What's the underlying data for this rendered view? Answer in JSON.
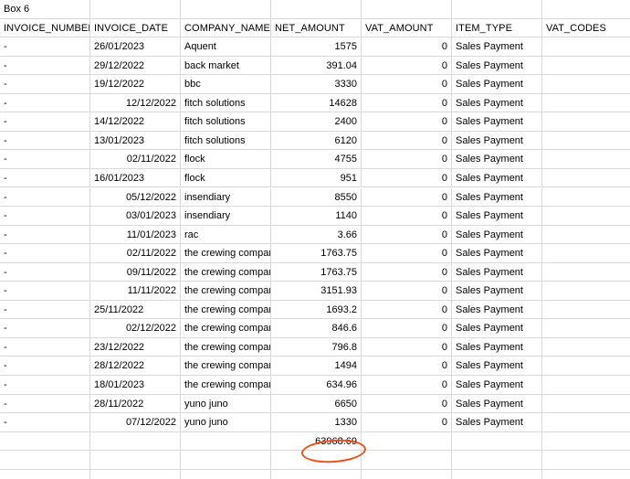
{
  "sheet": {
    "title": "Box 6",
    "headers": [
      "INVOICE_NUMBER",
      "INVOICE_DATE",
      "COMPANY_NAME",
      "NET_AMOUNT",
      "VAT_AMOUNT",
      "ITEM_TYPE",
      "VAT_CODES"
    ],
    "rows": [
      {
        "invoice_number": "-",
        "invoice_date": "26/01/2023",
        "date_align": "left",
        "company": "Aquent",
        "net": "1575",
        "vat": "0",
        "item_type": "Sales Payment",
        "vat_codes": ""
      },
      {
        "invoice_number": "-",
        "invoice_date": "29/12/2022",
        "date_align": "left",
        "company": "back market",
        "net": "391.04",
        "vat": "0",
        "item_type": "Sales Payment",
        "vat_codes": ""
      },
      {
        "invoice_number": "-",
        "invoice_date": "19/12/2022",
        "date_align": "left",
        "company": "bbc",
        "net": "3330",
        "vat": "0",
        "item_type": "Sales Payment",
        "vat_codes": ""
      },
      {
        "invoice_number": "-",
        "invoice_date": "12/12/2022",
        "date_align": "right",
        "company": "fitch solutions",
        "net": "14628",
        "vat": "0",
        "item_type": "Sales Payment",
        "vat_codes": ""
      },
      {
        "invoice_number": "-",
        "invoice_date": "14/12/2022",
        "date_align": "left",
        "company": "fitch solutions",
        "net": "2400",
        "vat": "0",
        "item_type": "Sales Payment",
        "vat_codes": ""
      },
      {
        "invoice_number": "-",
        "invoice_date": "13/01/2023",
        "date_align": "left",
        "company": "fitch solutions",
        "net": "6120",
        "vat": "0",
        "item_type": "Sales Payment",
        "vat_codes": ""
      },
      {
        "invoice_number": "-",
        "invoice_date": "02/11/2022",
        "date_align": "right",
        "company": "flock",
        "net": "4755",
        "vat": "0",
        "item_type": "Sales Payment",
        "vat_codes": ""
      },
      {
        "invoice_number": "-",
        "invoice_date": "16/01/2023",
        "date_align": "left",
        "company": "flock",
        "net": "951",
        "vat": "0",
        "item_type": "Sales Payment",
        "vat_codes": ""
      },
      {
        "invoice_number": "-",
        "invoice_date": "05/12/2022",
        "date_align": "right",
        "company": "insendiary",
        "net": "8550",
        "vat": "0",
        "item_type": "Sales Payment",
        "vat_codes": ""
      },
      {
        "invoice_number": "-",
        "invoice_date": "03/01/2023",
        "date_align": "right",
        "company": "insendiary",
        "net": "1140",
        "vat": "0",
        "item_type": "Sales Payment",
        "vat_codes": ""
      },
      {
        "invoice_number": "-",
        "invoice_date": "11/01/2023",
        "date_align": "right",
        "company": "rac",
        "net": "3.66",
        "vat": "0",
        "item_type": "Sales Payment",
        "vat_codes": ""
      },
      {
        "invoice_number": "-",
        "invoice_date": "02/11/2022",
        "date_align": "right",
        "company": "the crewing compan",
        "net": "1763.75",
        "vat": "0",
        "item_type": "Sales Payment",
        "vat_codes": ""
      },
      {
        "invoice_number": "-",
        "invoice_date": "09/11/2022",
        "date_align": "right",
        "company": "the crewing compan",
        "net": "1763.75",
        "vat": "0",
        "item_type": "Sales Payment",
        "vat_codes": ""
      },
      {
        "invoice_number": "-",
        "invoice_date": "11/11/2022",
        "date_align": "right",
        "company": "the crewing compan",
        "net": "3151.93",
        "vat": "0",
        "item_type": "Sales Payment",
        "vat_codes": ""
      },
      {
        "invoice_number": "-",
        "invoice_date": "25/11/2022",
        "date_align": "left",
        "company": "the crewing compan",
        "net": "1693.2",
        "vat": "0",
        "item_type": "Sales Payment",
        "vat_codes": ""
      },
      {
        "invoice_number": "-",
        "invoice_date": "02/12/2022",
        "date_align": "right",
        "company": "the crewing compan",
        "net": "846.6",
        "vat": "0",
        "item_type": "Sales Payment",
        "vat_codes": ""
      },
      {
        "invoice_number": "-",
        "invoice_date": "23/12/2022",
        "date_align": "left",
        "company": "the crewing compan",
        "net": "796.8",
        "vat": "0",
        "item_type": "Sales Payment",
        "vat_codes": ""
      },
      {
        "invoice_number": "-",
        "invoice_date": "28/12/2022",
        "date_align": "left",
        "company": "the crewing compan",
        "net": "1494",
        "vat": "0",
        "item_type": "Sales Payment",
        "vat_codes": ""
      },
      {
        "invoice_number": "-",
        "invoice_date": "18/01/2023",
        "date_align": "left",
        "company": "the crewing compan",
        "net": "634.96",
        "vat": "0",
        "item_type": "Sales Payment",
        "vat_codes": ""
      },
      {
        "invoice_number": "-",
        "invoice_date": "28/11/2022",
        "date_align": "left",
        "company": "yuno juno",
        "net": "6650",
        "vat": "0",
        "item_type": "Sales Payment",
        "vat_codes": ""
      },
      {
        "invoice_number": "-",
        "invoice_date": "07/12/2022",
        "date_align": "right",
        "company": "yuno juno",
        "net": "1330",
        "vat": "0",
        "item_type": "Sales Payment",
        "vat_codes": ""
      }
    ],
    "total": "63968.69",
    "annotation_color": "#e8521b"
  }
}
